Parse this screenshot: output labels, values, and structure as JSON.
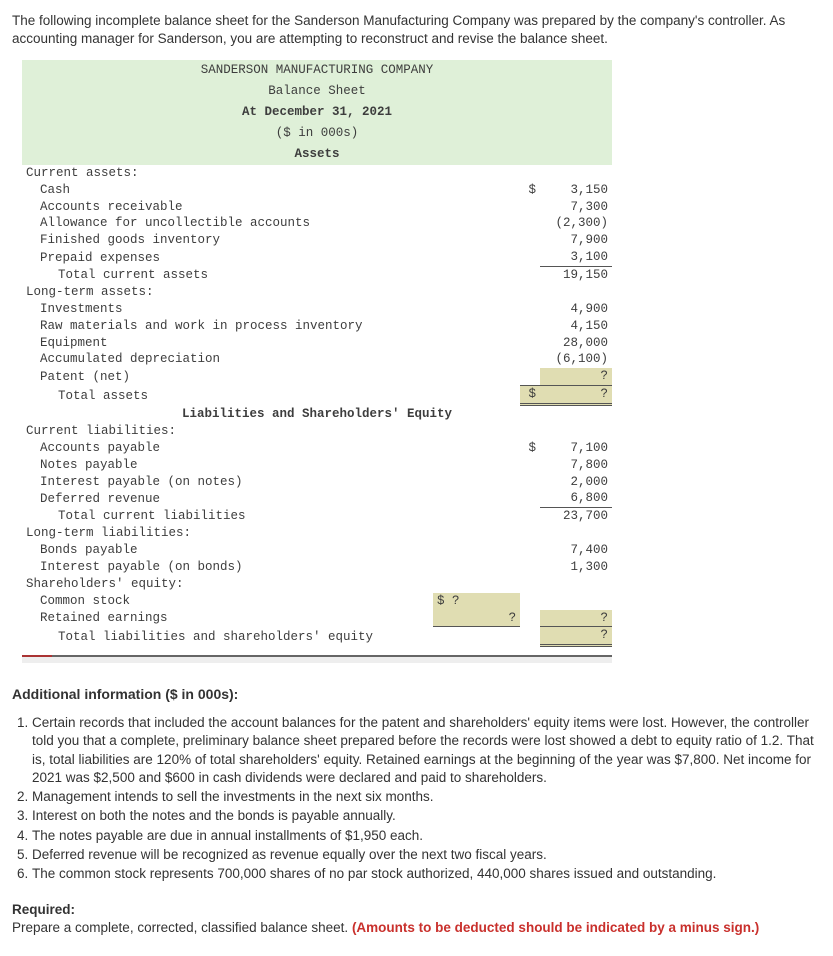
{
  "intro": "The following incomplete balance sheet for the Sanderson Manufacturing Company was prepared by the company's controller. As accounting manager for Sanderson, you are attempting to reconstruct and revise the balance sheet.",
  "header": {
    "company": "SANDERSON MANUFACTURING COMPANY",
    "title": "Balance Sheet",
    "date": "At December 31, 2021",
    "units": "($ in 000s)",
    "assets_hdr": "Assets",
    "liab_hdr": "Liabilities and Shareholders' Equity"
  },
  "labels": {
    "ca": "Current assets:",
    "cash": "Cash",
    "ar": "Accounts receivable",
    "allow": "Allowance for uncollectible accounts",
    "fg": "Finished goods inventory",
    "prepaid": "Prepaid expenses",
    "tca": "Total current assets",
    "lta": "Long-term assets:",
    "inv": "Investments",
    "rawwip": "Raw materials and work in process inventory",
    "equip": "Equipment",
    "accdep": "Accumulated depreciation",
    "patent": "Patent (net)",
    "ta": "Total assets",
    "cl": "Current liabilities:",
    "ap": "Accounts payable",
    "np": "Notes payable",
    "ipn": "Interest payable (on notes)",
    "defrev": "Deferred revenue",
    "tcl": "Total current liabilities",
    "ltl": "Long-term liabilities:",
    "bp": "Bonds payable",
    "ipb": "Interest payable (on bonds)",
    "se": "Shareholders' equity:",
    "cs": "Common stock",
    "re": "Retained earnings",
    "tlse": "Total liabilities and shareholders' equity"
  },
  "vals": {
    "cash": "3,150",
    "ar": "7,300",
    "allow": "(2,300)",
    "fg": "7,900",
    "prepaid": "3,100",
    "tca": "19,150",
    "inv": "4,900",
    "rawwip": "4,150",
    "equip": "28,000",
    "accdep": "(6,100)",
    "patent": "?",
    "ta": "?",
    "ap": "7,100",
    "np": "7,800",
    "ipn": "2,000",
    "defrev": "6,800",
    "tcl": "23,700",
    "bp": "7,400",
    "ipb": "1,300",
    "cs": "?",
    "re_c": "?",
    "re": "?",
    "tlse": "?"
  },
  "cur": {
    "d": "$",
    "dq": "$ ?"
  },
  "addl_title": "Additional information ($ in 000s):",
  "info": [
    "Certain records that included the account balances for the patent and shareholders' equity items were lost. However, the controller told you that a complete, preliminary balance sheet prepared before the records were lost showed a debt to equity ratio of 1.2. That is, total liabilities are 120% of total shareholders' equity. Retained earnings at the beginning of the year was $7,800. Net income for 2021 was $2,500 and $600 in cash dividends were declared and paid to shareholders.",
    "Management intends to sell the investments in the next six months.",
    "Interest on both the notes and the bonds is payable annually.",
    "The notes payable are due in annual installments of $1,950 each.",
    "Deferred revenue will be recognized as revenue equally over the next two fiscal years.",
    "The common stock represents 700,000 shares of no par stock authorized, 440,000 shares issued and outstanding."
  ],
  "required": {
    "label": "Required:",
    "text": "Prepare a complete, corrected, classified balance sheet. ",
    "red": "(Amounts to be deducted should be indicated by a minus sign.)"
  }
}
